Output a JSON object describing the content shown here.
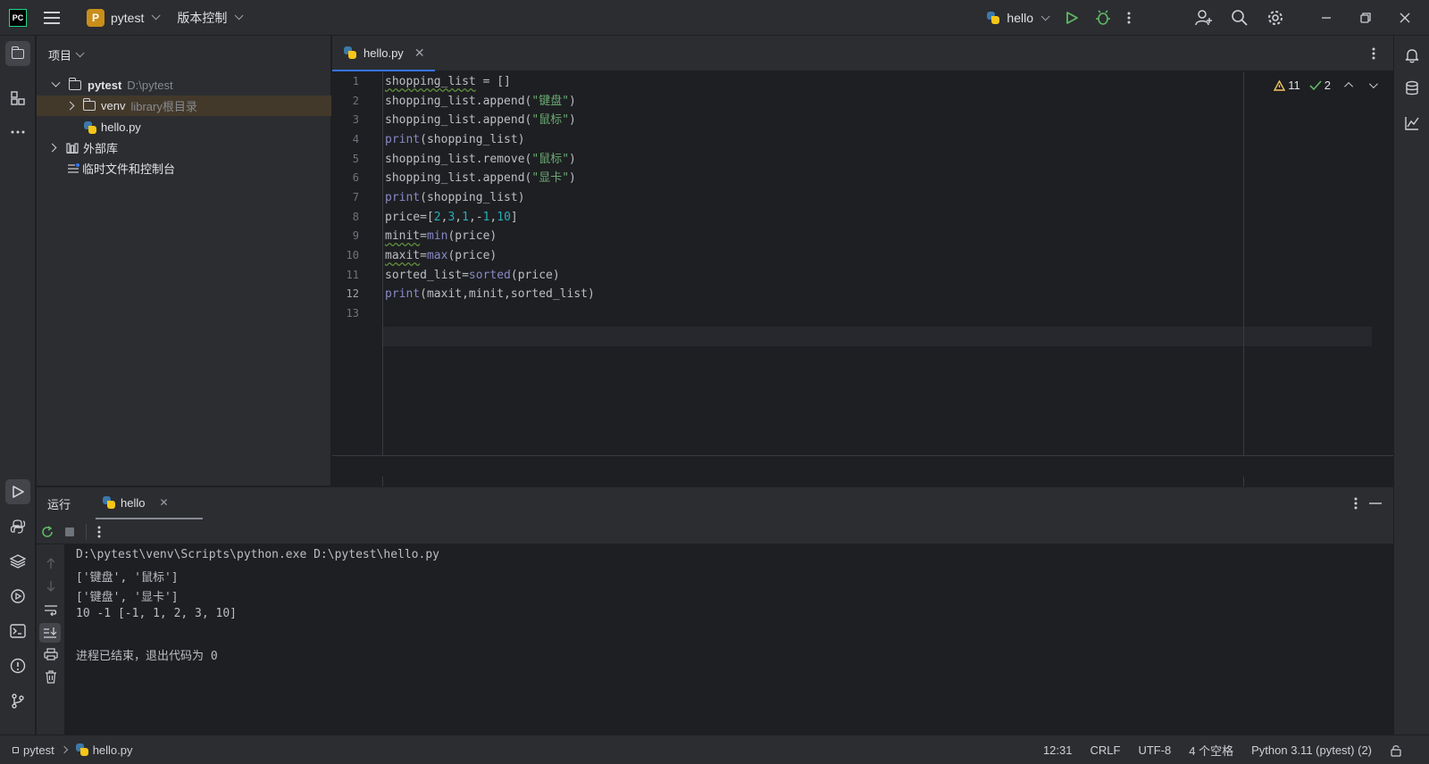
{
  "titlebar": {
    "logo_text": "PC",
    "project_badge": "P",
    "project_name": "pytest",
    "vcs_label": "版本控制",
    "run_config": "hello"
  },
  "project_panel": {
    "title": "项目",
    "tree": [
      {
        "label": "pytest",
        "hint": "D:\\pytest"
      },
      {
        "label": "venv",
        "hint": "library根目录"
      },
      {
        "label": "hello.py",
        "hint": ""
      },
      {
        "label": "外部库",
        "hint": ""
      },
      {
        "label": "临时文件和控制台",
        "hint": ""
      }
    ]
  },
  "editor": {
    "tab_label": "hello.py",
    "warnings_count": "11",
    "weak_warnings_count": "2",
    "line_numbers": [
      "1",
      "2",
      "3",
      "4",
      "5",
      "6",
      "7",
      "8",
      "9",
      "10",
      "11",
      "12",
      "13"
    ],
    "current_line": 12
  },
  "run_panel": {
    "title": "运行",
    "tab_label": "hello",
    "console_lines": [
      "D:\\pytest\\venv\\Scripts\\python.exe D:\\pytest\\hello.py",
      "['键盘', '鼠标']",
      "['键盘', '显卡']",
      "10 -1 [-1, 1, 2, 3, 10]",
      "",
      "进程已结束，退出代码为 0"
    ]
  },
  "statusbar": {
    "breadcrumb_project": "pytest",
    "breadcrumb_file": "hello.py",
    "caret": "12:31",
    "line_sep": "CRLF",
    "encoding": "UTF-8",
    "indent": "4 个空格",
    "interpreter": "Python 3.11 (pytest) (2)"
  },
  "colors": {
    "accent": "#3574f0",
    "run_green": "#5fb865",
    "selection": "#43392b"
  }
}
